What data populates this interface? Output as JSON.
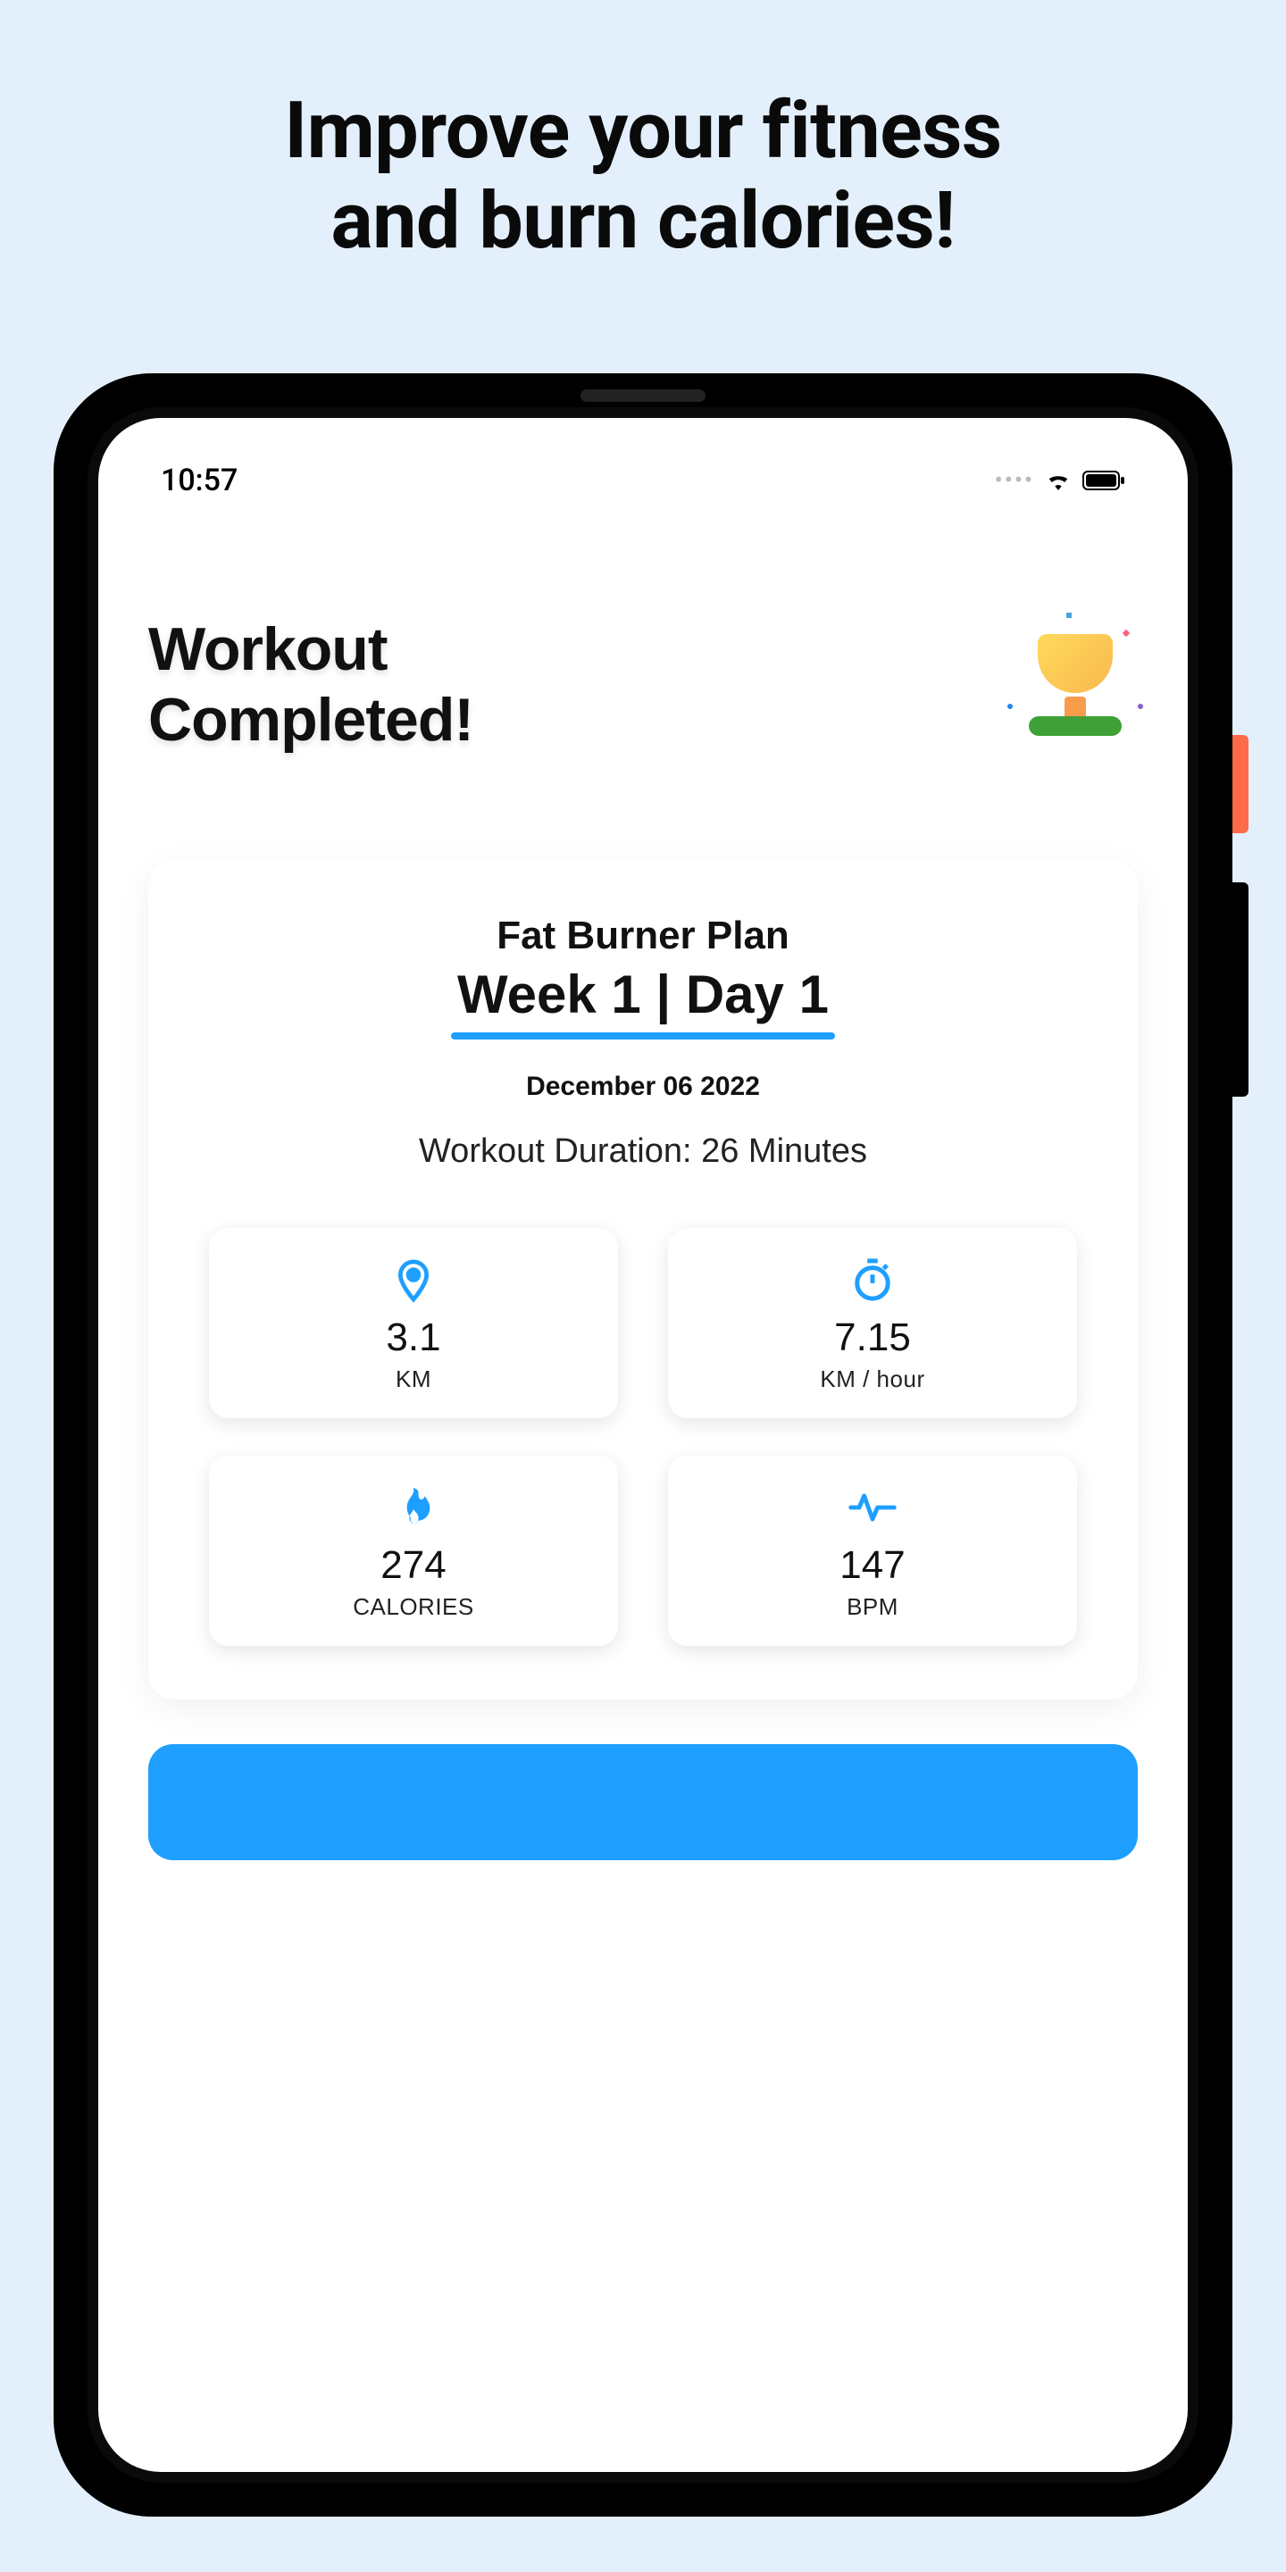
{
  "promo": {
    "headline_line1": "Improve your fitness",
    "headline_line2": "and burn calories!"
  },
  "statusbar": {
    "time": "10:57"
  },
  "screen": {
    "title_line1": "Workout",
    "title_line2": "Completed!",
    "card": {
      "plan_name": "Fat Burner Plan",
      "week_day": "Week 1 | Day 1",
      "date": "December 06 2022",
      "duration": "Workout Duration: 26 Minutes",
      "stats": {
        "distance": {
          "value": "3.1",
          "label": "KM"
        },
        "speed": {
          "value": "7.15",
          "label": "KM / hour"
        },
        "calories": {
          "value": "274",
          "label": "CALORIES"
        },
        "bpm": {
          "value": "147",
          "label": "BPM"
        }
      }
    }
  },
  "colors": {
    "accent": "#1e9fff",
    "page_bg": "#e3f0fc"
  }
}
